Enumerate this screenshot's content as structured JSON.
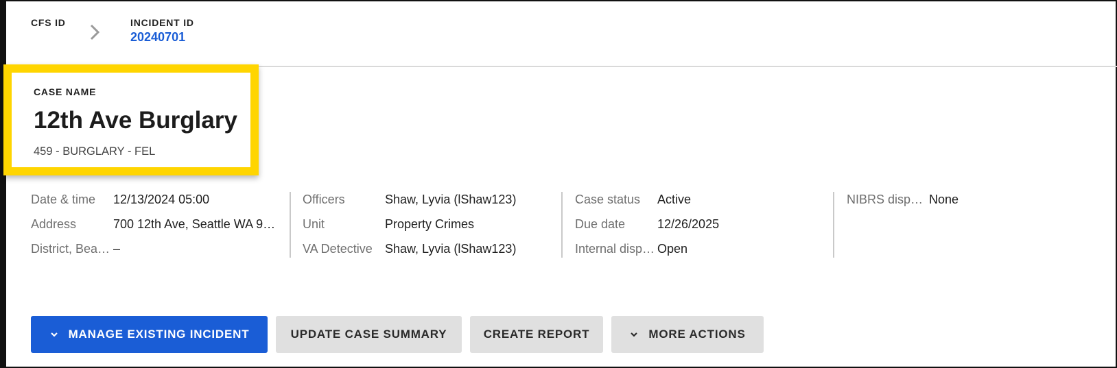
{
  "breadcrumb": {
    "cfs_label": "CFS ID",
    "incident_label": "INCIDENT ID",
    "incident_value": "20240701"
  },
  "case": {
    "label": "CASE NAME",
    "title": "12th Ave Burglary",
    "subtitle": "459 - BURGLARY - FEL"
  },
  "details": {
    "col1": [
      {
        "label": "Date & time",
        "value": "12/13/2024 05:00"
      },
      {
        "label": "Address",
        "value": "700 12th Ave, Seattle WA 98…"
      },
      {
        "label": "District, Beat,…",
        "value": "–"
      }
    ],
    "col2": [
      {
        "label": "Officers",
        "value": "Shaw, Lyvia (lShaw123)"
      },
      {
        "label": "Unit",
        "value": "Property Crimes"
      },
      {
        "label": "VA Detective",
        "value": "Shaw, Lyvia (lShaw123)"
      }
    ],
    "col3": [
      {
        "label": "Case status",
        "value": "Active"
      },
      {
        "label": "Due date",
        "value": "12/26/2025"
      },
      {
        "label": "Internal disp…",
        "value": "Open"
      }
    ],
    "col4": [
      {
        "label": "NIBRS dispo…",
        "value": "None"
      }
    ]
  },
  "actions": {
    "manage_label": "MANAGE EXISTING INCIDENT",
    "update_label": "UPDATE CASE SUMMARY",
    "create_label": "CREATE REPORT",
    "more_label": "MORE ACTIONS"
  },
  "colors": {
    "accent": "#1a5dd6",
    "highlight": "#ffd500",
    "secondary_button": "#e0e0e0"
  },
  "icons": {
    "breadcrumb_separator": "chevron-right-icon",
    "dropdown": "chevron-down-icon"
  }
}
